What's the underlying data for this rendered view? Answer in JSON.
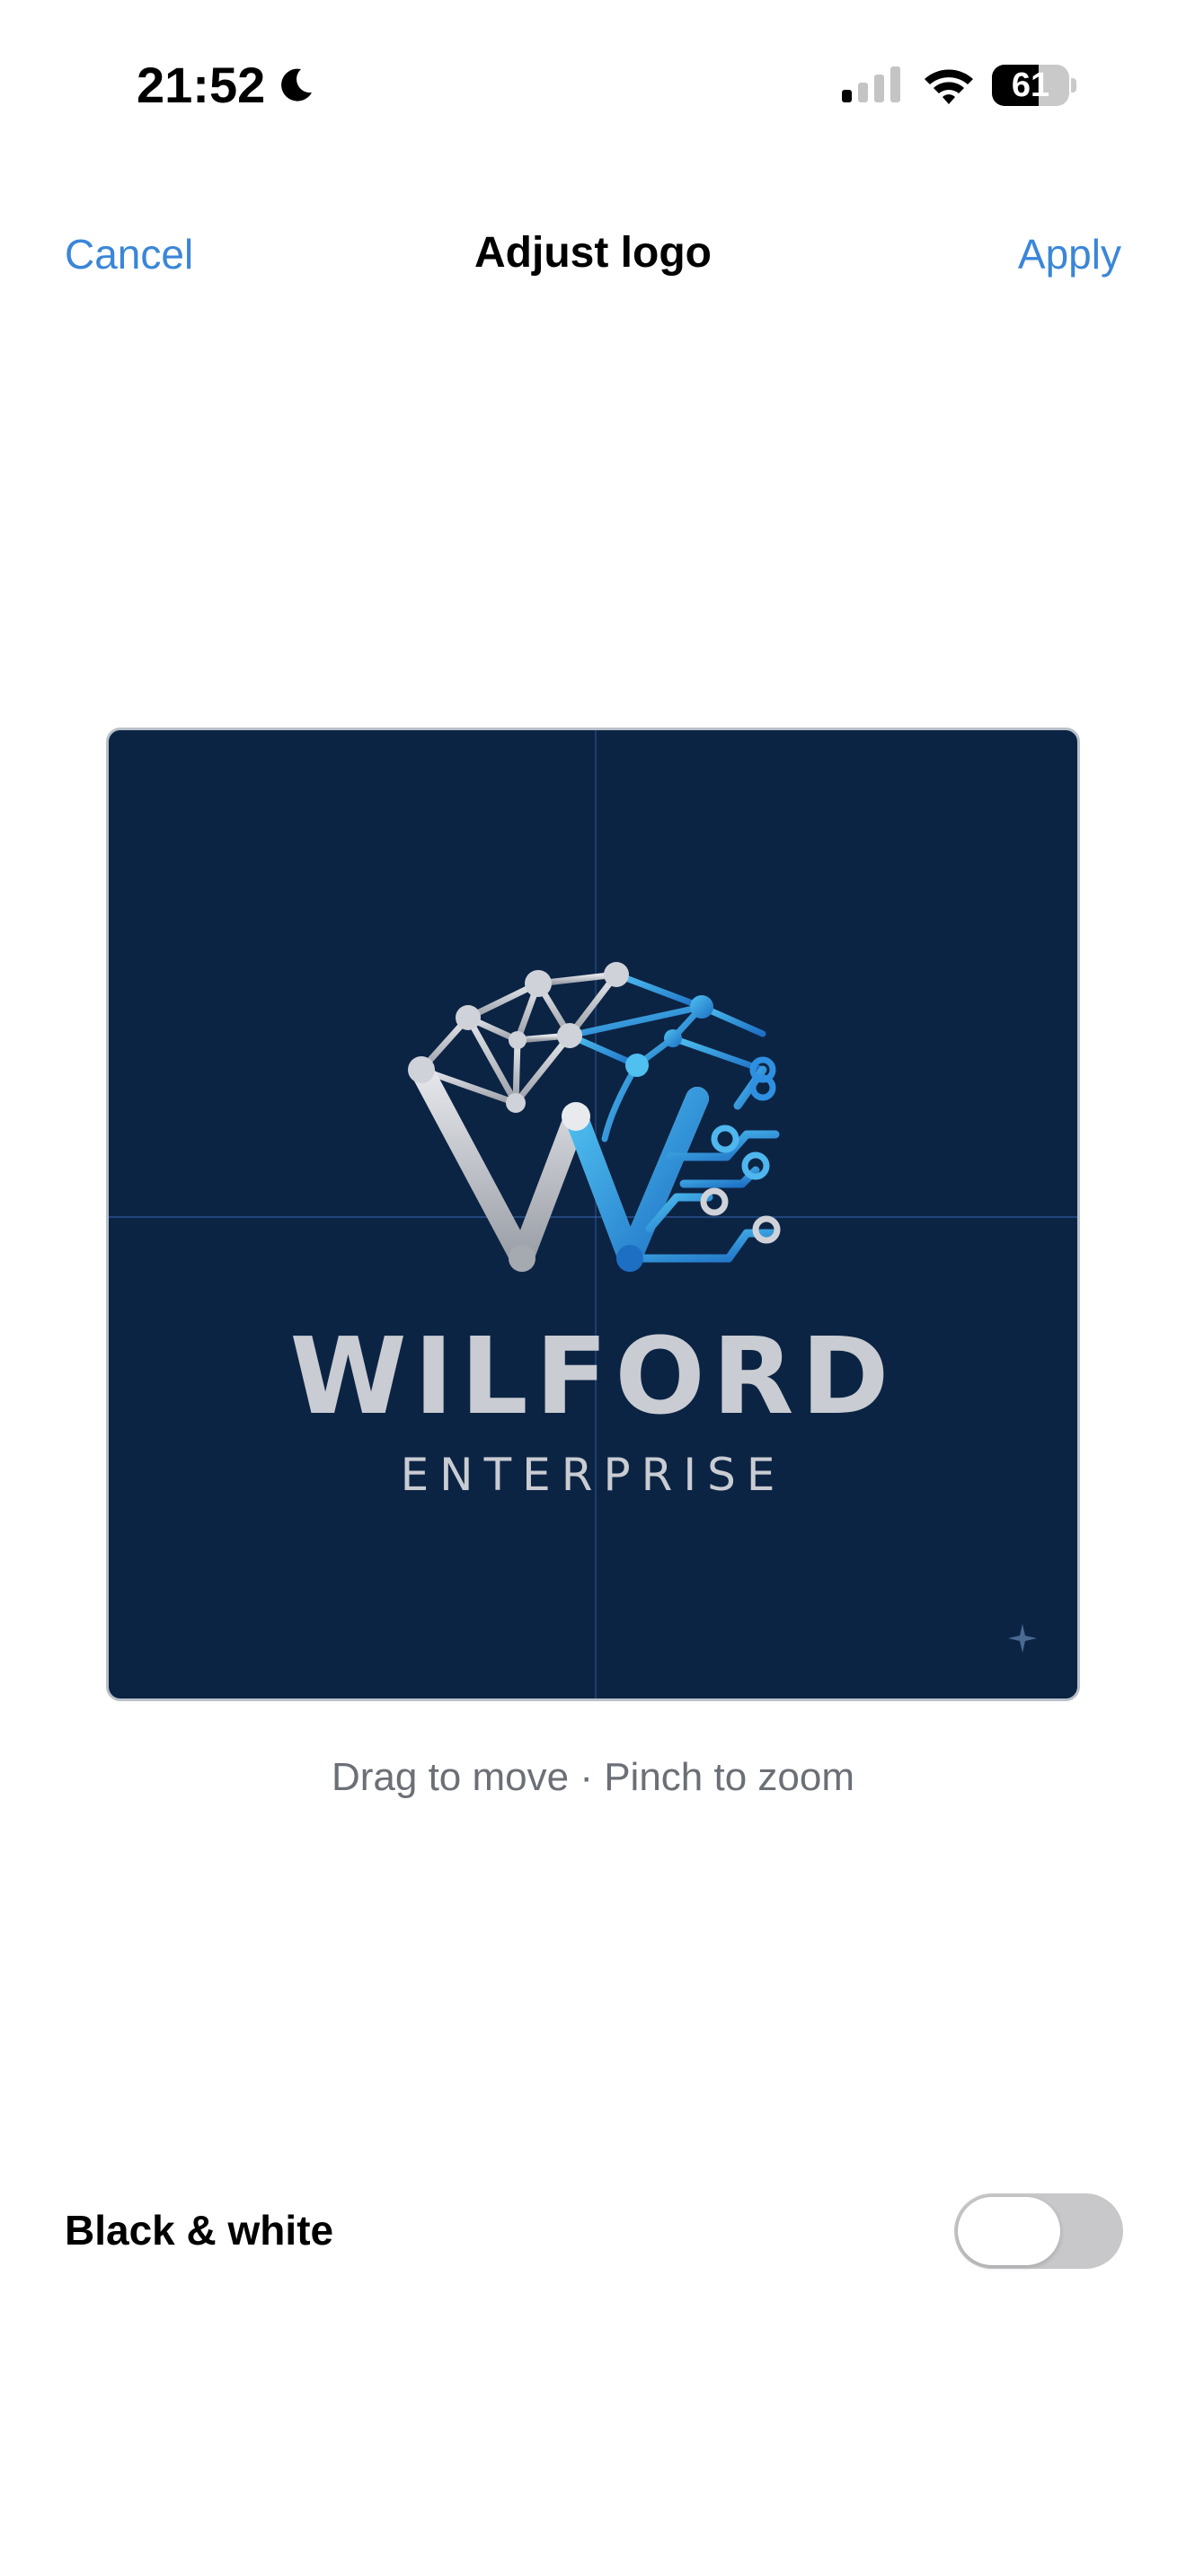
{
  "status_bar": {
    "time": "21:52",
    "battery_level": "61",
    "battery_fraction": 0.61,
    "icons": [
      "moon-icon",
      "cellular-signal-icon",
      "wifi-icon",
      "battery-icon"
    ]
  },
  "nav": {
    "cancel_label": "Cancel",
    "title": "Adjust logo",
    "apply_label": "Apply"
  },
  "logo": {
    "name": "WILFORD",
    "subtitle": "ENTERPRISE",
    "background_color": "#0c2444",
    "silver_color": "#c9ccd2",
    "blue_color": "#2f8fe0",
    "icon": "we-network-monogram-icon"
  },
  "hint": "Drag to move · Pinch to zoom",
  "options": {
    "bw_label": "Black & white",
    "bw_enabled": false
  },
  "colors": {
    "accent": "#3a86d8"
  }
}
